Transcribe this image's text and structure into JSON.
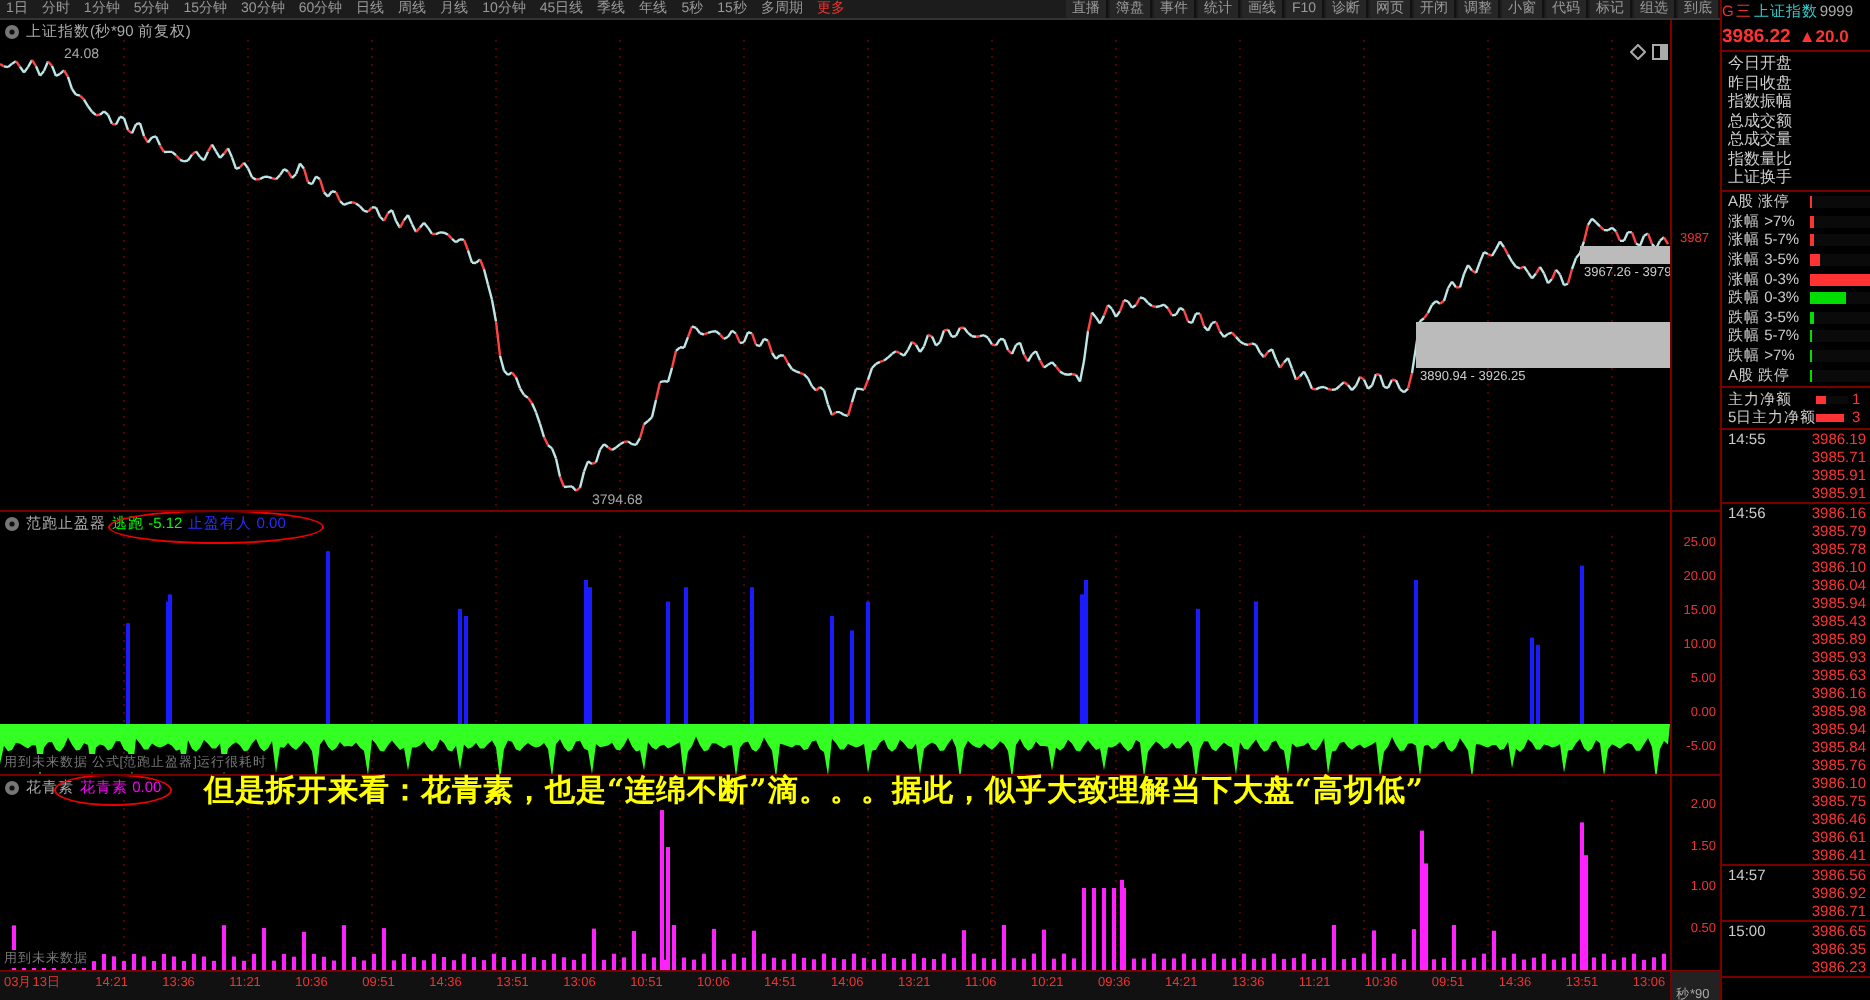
{
  "toolbar": {
    "periods": [
      "1日",
      "分时",
      "1分钟",
      "5分钟",
      "15分钟",
      "30分钟",
      "60分钟",
      "日线",
      "周线",
      "月线",
      "10分钟",
      "45日线",
      "季线",
      "年线",
      "5秒",
      "15秒",
      "多周期"
    ],
    "more": "更多",
    "tools": [
      "直播",
      "簿盘",
      "事件",
      "统计",
      "画线",
      "F10",
      "诊断",
      "网页",
      "开闭",
      "调整",
      "小窗",
      "代码",
      "标记",
      "组选",
      "到底"
    ]
  },
  "quote": {
    "flag": "G",
    "menu": "三",
    "name": "上证指数",
    "code": "9999",
    "price": "3986.22",
    "change": "▲20.0"
  },
  "price_chart": {
    "title": "上证指数(秒*90 前复权)",
    "high_label": "24.08",
    "low_label": "3794.68",
    "axis_label": "3987",
    "zones": [
      {
        "label": "3890.94 - 3926.25"
      },
      {
        "label": "3967.26 - 3979"
      }
    ]
  },
  "indicator_1": {
    "name": "范跑止盈器",
    "values": [
      {
        "label": "逃跑",
        "value": "-5.12",
        "color": "#00ff00"
      },
      {
        "label": "止盈有人",
        "value": "0.00",
        "color": "#2b2bff"
      }
    ],
    "notice": "用到未来数据 公式[范跑止盈器]运行很耗时",
    "yticks": [
      "25.00",
      "20.00",
      "15.00",
      "10.00",
      "5.00",
      "0.00",
      "-5.00"
    ]
  },
  "indicator_2": {
    "name": "花青素",
    "values": [
      {
        "label": "花青素",
        "value": "0.00",
        "color": "#ff00ff"
      }
    ],
    "notice": "用到未来数据",
    "yticks": [
      "2.00",
      "1.50",
      "1.00",
      "0.50"
    ]
  },
  "caption": "但是拆开来看：花青素，也是“连绵不断”滴。。。据此，似乎大致理解当下大盘“高切低”",
  "x_axis": {
    "labels": [
      "03月13日",
      "14:21",
      "13:36",
      "11:21",
      "10:36",
      "09:51",
      "14:36",
      "13:51",
      "13:06",
      "10:51",
      "10:06",
      "14:51",
      "14:06",
      "13:21",
      "11:06",
      "10:21",
      "09:36",
      "14:21",
      "13:36",
      "11:21",
      "10:36",
      "09:51",
      "14:36",
      "13:51",
      "13:06"
    ],
    "unit": "秒*90"
  },
  "stats": [
    "今日开盘",
    "昨日收盘",
    "指数振幅",
    "总成交额",
    "总成交量",
    "指数量比",
    "上证换手"
  ],
  "breadth": [
    {
      "label": "A股 涨停",
      "kind": "up",
      "level": 0.03
    },
    {
      "label": "涨幅 >7%",
      "kind": "up",
      "level": 0.06
    },
    {
      "label": "涨幅 5-7%",
      "kind": "up",
      "level": 0.06
    },
    {
      "label": "涨幅 3-5%",
      "kind": "up",
      "level": 0.17
    },
    {
      "label": "涨幅 0-3%",
      "kind": "up",
      "level": 1
    },
    {
      "label": "跌幅 0-3%",
      "kind": "down",
      "level": 0.6
    },
    {
      "label": "跌幅 3-5%",
      "kind": "down",
      "level": 0.05
    },
    {
      "label": "跌幅 5-7%",
      "kind": "down",
      "level": 0.03
    },
    {
      "label": "跌幅 >7%",
      "kind": "down",
      "level": 0.03
    },
    {
      "label": "A股 跌停",
      "kind": "down",
      "level": 0.03
    }
  ],
  "capital": [
    {
      "label": "主力净额",
      "value": "1",
      "level": 0.3
    },
    {
      "label": "5日主力净额",
      "value": "3",
      "level": 0.9
    }
  ],
  "ticks": [
    {
      "time": "14:55",
      "prices": [
        "3986.19",
        "3985.71",
        "3985.91",
        "3985.91"
      ]
    },
    {
      "time": "14:56",
      "prices": [
        "3986.16",
        "3985.79",
        "3985.78",
        "3986.10",
        "3986.04",
        "3985.94",
        "3985.43",
        "3985.89",
        "3985.93",
        "3985.63",
        "3986.16",
        "3985.98",
        "3985.94",
        "3985.84",
        "3985.76",
        "3986.10",
        "3985.75",
        "3986.46",
        "3986.61",
        "3986.41"
      ]
    },
    {
      "time": "14:57",
      "prices": [
        "3986.56",
        "3986.92",
        "3986.71"
      ]
    },
    {
      "time": "15:00",
      "prices": [
        "3986.65",
        "3986.35",
        "3986.23"
      ]
    }
  ]
}
